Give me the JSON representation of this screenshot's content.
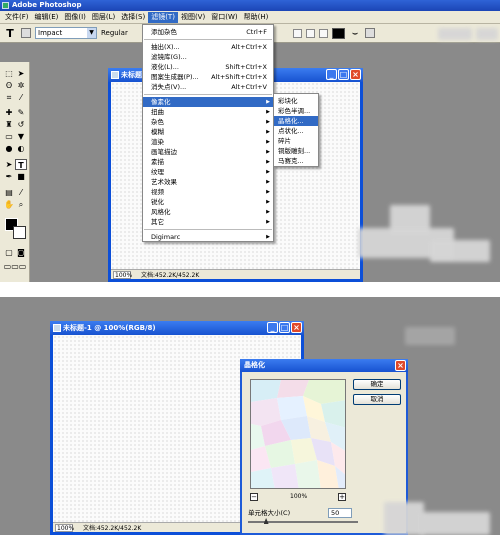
{
  "top": {
    "app_title": "Adobe Photoshop",
    "menu": [
      "文件(F)",
      "编辑(E)",
      "图像(I)",
      "图层(L)",
      "选择(S)",
      "滤镜(T)",
      "视图(V)",
      "窗口(W)",
      "帮助(H)"
    ],
    "options": {
      "tool_glyph": "T",
      "font_family": "Impact",
      "font_style": "Regular"
    },
    "document": {
      "title": "未标题-1",
      "zoom": "100%",
      "doc_size": "文档:452.2K/452.2K"
    },
    "filter_menu": {
      "items": [
        {
          "label": "添加杂色",
          "shortcut": "Ctrl+F"
        },
        {
          "label": "抽出(X)...",
          "shortcut": "Alt+Ctrl+X"
        },
        {
          "label": "滤镜库(G)...",
          "shortcut": ""
        },
        {
          "label": "液化(L)...",
          "shortcut": "Shift+Ctrl+X"
        },
        {
          "label": "图案生成器(P)...",
          "shortcut": "Alt+Shift+Ctrl+X"
        },
        {
          "label": "消失点(V)...",
          "shortcut": "Alt+Ctrl+V"
        }
      ],
      "submenus": [
        "像素化",
        "扭曲",
        "杂色",
        "模糊",
        "渲染",
        "画笔描边",
        "素描",
        "纹理",
        "艺术效果",
        "视频",
        "锐化",
        "风格化",
        "其它"
      ],
      "last": "Digimarc"
    },
    "pixelate_menu": [
      "彩块化",
      "彩色半调...",
      "晶格化...",
      "点状化...",
      "碎片",
      "铜版雕刻...",
      "马赛克..."
    ]
  },
  "bottom": {
    "document": {
      "title": "未标题-1 @ 100%(RGB/8)",
      "zoom": "100%",
      "doc_size": "文档:452.2K/452.2K"
    },
    "dialog": {
      "title": "晶格化",
      "ok_label": "确定",
      "cancel_label": "取消",
      "zoom_minus": "−",
      "zoom_plus": "+",
      "preview_zoom": "100%",
      "cell_size_label": "单元格大小(C)",
      "cell_size_value": "50",
      "cell_size_fraction": 0.16
    }
  },
  "colors": {
    "xp_blue": "#1752d0",
    "highlight": "#316ac5",
    "workspace": "#8a8a8a",
    "chrome": "#ece9d8"
  }
}
